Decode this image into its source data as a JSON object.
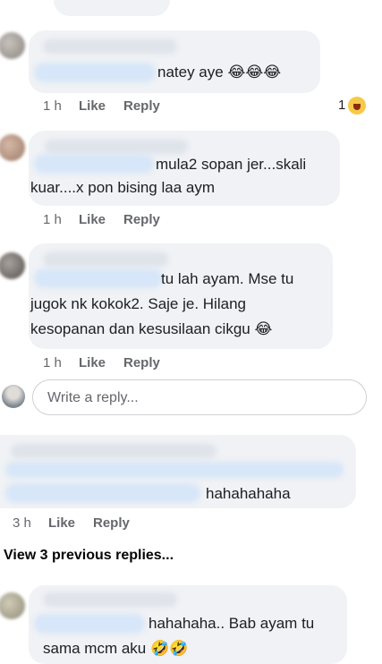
{
  "comments": [
    {
      "text_lines": [
        "natey aye"
      ],
      "emoji": "😂😂😂",
      "time": "1 h",
      "like": "Like",
      "reply": "Reply",
      "reaction_count": "1"
    },
    {
      "text_lines": [
        "mula2 sopan jer...skali",
        "kuar....x pon bising laa aym"
      ],
      "time": "1 h",
      "like": "Like",
      "reply": "Reply"
    },
    {
      "text_lines": [
        "tu lah ayam. Mse tu",
        "jugok nk kokok2. Saje je. Hilang",
        "kesopanan dan kesusilaan cikgu"
      ],
      "emoji": "😂",
      "time": "1 h",
      "like": "Like",
      "reply": "Reply"
    },
    {
      "text_lines": [
        "hahahahaha"
      ],
      "time": "3 h",
      "like": "Like",
      "reply": "Reply"
    },
    {
      "text_lines": [
        "hahahaha.. Bab ayam tu",
        "sama mcm aku"
      ],
      "emoji": "🤣🤣"
    }
  ],
  "reply_input": {
    "placeholder": "Write a reply..."
  },
  "view_previous": "View 3 previous replies..."
}
